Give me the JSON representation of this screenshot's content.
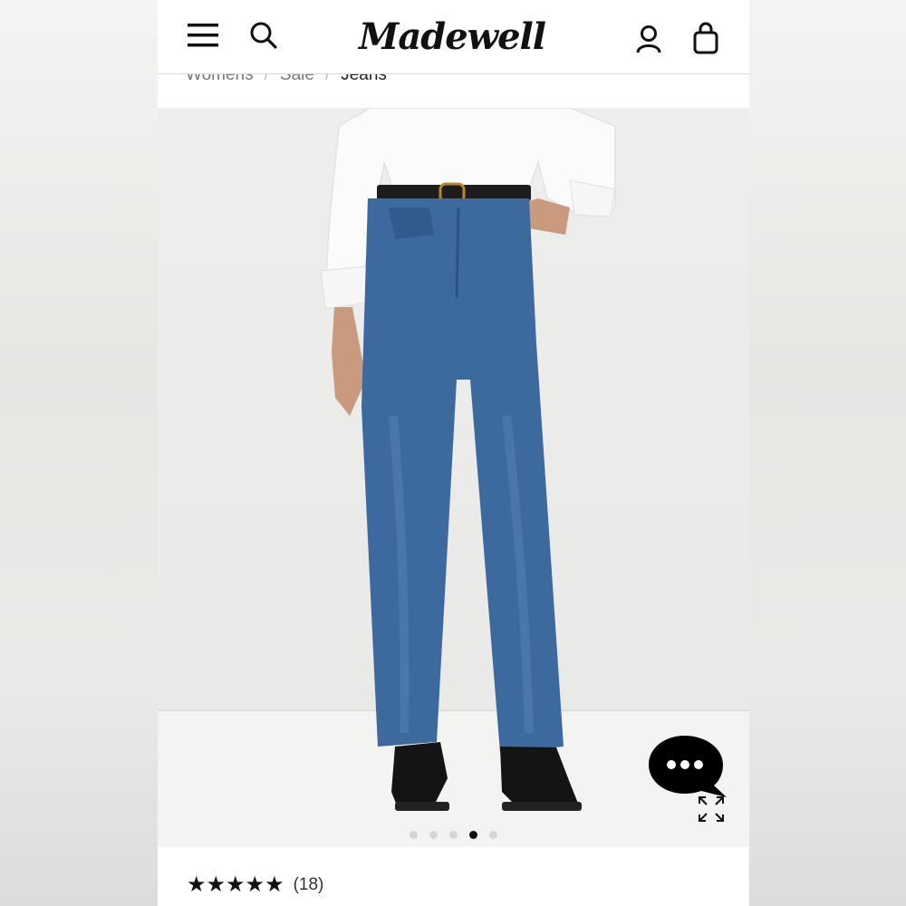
{
  "header": {
    "logo": "Madewell",
    "icons": {
      "menu": "hamburger-menu-icon",
      "search": "search-icon",
      "account": "user-account-icon",
      "bag": "shopping-bag-icon"
    }
  },
  "breadcrumb": {
    "items": [
      "Womens",
      "Sale",
      "Jeans"
    ],
    "separator": "/"
  },
  "product_image": {
    "alt": "Model wearing high-rise straight-leg medium wash jeans with a white shirt and black loafers"
  },
  "carousel": {
    "total": 5,
    "active_index": 3
  },
  "chat": {
    "icon": "chat-bubble-icon",
    "expand_icon": "expand-icon"
  },
  "rating": {
    "stars": "★★★★★",
    "value": 5,
    "max": 5,
    "review_count": "(18)"
  },
  "colors": {
    "denim": "#3d6a9e",
    "denim_dark": "#2c5282",
    "shirt": "#ffffff",
    "ink": "#111111"
  }
}
